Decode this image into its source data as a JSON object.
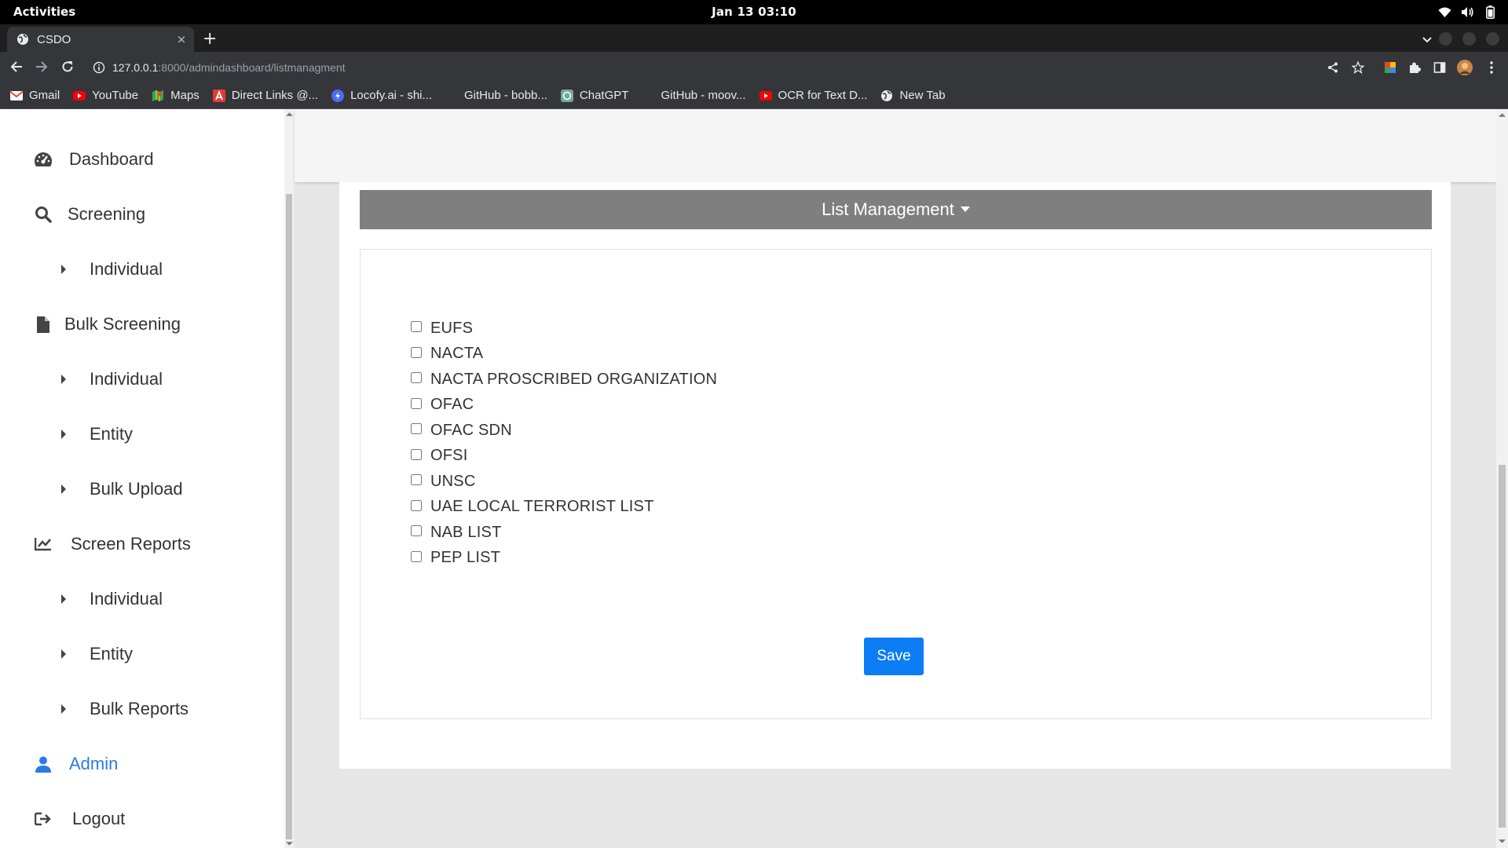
{
  "system": {
    "activities": "Activities",
    "clock": "Jan 13  03:10"
  },
  "browser": {
    "tab_title": "CSDO",
    "tab_close": "×",
    "new_tab": "+",
    "url_host": "127.0.0.1",
    "url_path": ":8000/admindashboard/listmanagment",
    "bookmarks": [
      {
        "label": "Gmail",
        "icon": "gmail-icon"
      },
      {
        "label": "YouTube",
        "icon": "youtube-icon"
      },
      {
        "label": "Maps",
        "icon": "maps-icon"
      },
      {
        "label": "Direct Links @...",
        "icon": "direct-links-icon"
      },
      {
        "label": "Locofy.ai - shi...",
        "icon": "locofy-icon"
      },
      {
        "label": "GitHub - bobb...",
        "icon": "github-icon"
      },
      {
        "label": "ChatGPT",
        "icon": "chatgpt-icon"
      },
      {
        "label": "GitHub - moov...",
        "icon": "github-icon"
      },
      {
        "label": "OCR for Text D...",
        "icon": "youtube-icon"
      },
      {
        "label": "New Tab",
        "icon": "globe-icon"
      }
    ]
  },
  "sidebar": {
    "dashboard": "Dashboard",
    "screening": "Screening",
    "screening_individual": "Individual",
    "bulk_screening": "Bulk Screening",
    "bulk_individual": "Individual",
    "bulk_entity": "Entity",
    "bulk_upload": "Bulk Upload",
    "screen_reports": "Screen Reports",
    "reports_individual": "Individual",
    "reports_entity": "Entity",
    "reports_bulk": "Bulk Reports",
    "admin": "Admin",
    "logout": "Logout"
  },
  "main": {
    "section_title": "List Management",
    "lists": [
      {
        "label": "EUFS",
        "checked": false
      },
      {
        "label": "NACTA",
        "checked": false
      },
      {
        "label": "NACTA PROSCRIBED ORGANIZATION",
        "checked": false
      },
      {
        "label": "OFAC",
        "checked": false
      },
      {
        "label": "OFAC SDN",
        "checked": false
      },
      {
        "label": "OFSI",
        "checked": false
      },
      {
        "label": "UNSC",
        "checked": false
      },
      {
        "label": "UAE LOCAL TERRORIST LIST",
        "checked": false
      },
      {
        "label": "NAB LIST",
        "checked": false
      },
      {
        "label": "PEP LIST",
        "checked": false
      }
    ],
    "save_label": "Save"
  },
  "colors": {
    "accent": "#0d7df5",
    "active_nav": "#2c7be5",
    "header_band": "#7f7f7f"
  }
}
